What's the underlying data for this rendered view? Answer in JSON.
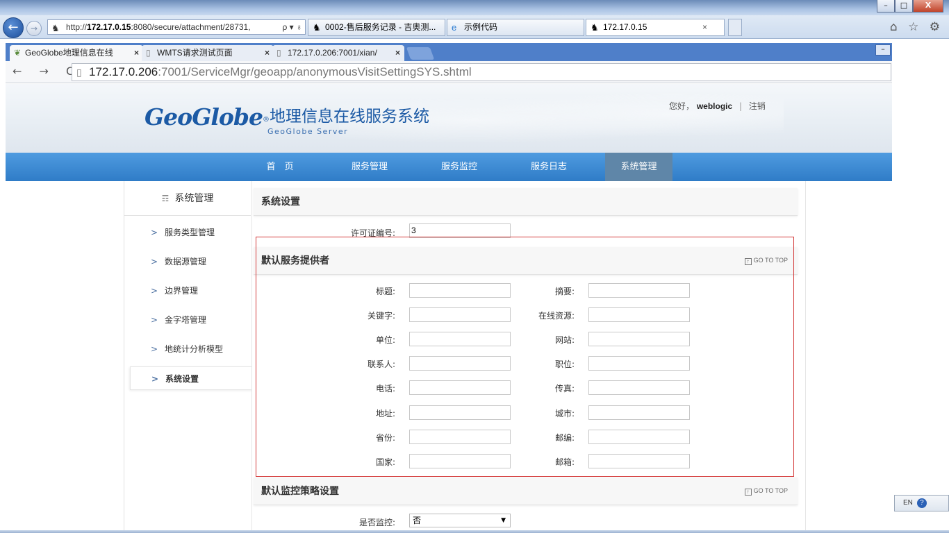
{
  "ie": {
    "address": {
      "prefix": "http://",
      "host": "172.17.0.15",
      "rest": ":8080/secure/attachment/28731,",
      "controls": "ρ ▾ ♁"
    },
    "tabs": [
      {
        "label": "0002-售后服务记录 - 吉奥测..."
      },
      {
        "label": "示例代码"
      },
      {
        "label": "172.17.0.15",
        "close": "×"
      }
    ],
    "right_icons": "⌂ ☆ ⚙",
    "window_buttons": [
      "–",
      "□",
      "X"
    ]
  },
  "chrome": {
    "tabs": [
      {
        "label": "GeoGlobe地理信息在线",
        "close": "×"
      },
      {
        "label": "WMTS请求测试页面",
        "close": "×"
      },
      {
        "label": "172.17.0.206:7001/xian/",
        "close": "×"
      }
    ],
    "url": {
      "host": "172.17.0.206",
      "rest": ":7001/ServiceMgr/geoapp/anonymousVisitSettingSYS.shtml"
    },
    "nav": "← → C"
  },
  "header": {
    "brand": "GeoGlobe",
    "reg": "®",
    "title_cn": "地理信息在线服务系统",
    "title_en": "GeoGlobe Server",
    "greeting": "您好，",
    "username": "weblogic",
    "separator": "|",
    "logout": "注销"
  },
  "nav": [
    {
      "label": "首　页"
    },
    {
      "label": "服务管理"
    },
    {
      "label": "服务监控"
    },
    {
      "label": "服务日志"
    },
    {
      "label": "系统管理",
      "active": true
    }
  ],
  "sidebar": {
    "title": "系统管理",
    "items": [
      {
        "label": "服务类型管理"
      },
      {
        "label": "数据源管理"
      },
      {
        "label": "边界管理"
      },
      {
        "label": "金字塔管理"
      },
      {
        "label": "地统计分析模型"
      },
      {
        "label": "系统设置",
        "active": true
      }
    ]
  },
  "content": {
    "system_settings": {
      "title": "系统设置",
      "license_label": "许可证编号:",
      "license_value": "3"
    },
    "provider": {
      "title": "默认服务提供者",
      "goto": "GO TO TOP",
      "fields_left": [
        {
          "label": "标题:",
          "value": ""
        },
        {
          "label": "关键字:",
          "value": ""
        },
        {
          "label": "单位:",
          "value": ""
        },
        {
          "label": "联系人:",
          "value": ""
        },
        {
          "label": "电话:",
          "value": ""
        },
        {
          "label": "地址:",
          "value": ""
        },
        {
          "label": "省份:",
          "value": ""
        },
        {
          "label": "国家:",
          "value": ""
        }
      ],
      "fields_right": [
        {
          "label": "摘要:",
          "value": ""
        },
        {
          "label": "在线资源:",
          "value": ""
        },
        {
          "label": "网站:",
          "value": ""
        },
        {
          "label": "职位:",
          "value": ""
        },
        {
          "label": "传真:",
          "value": ""
        },
        {
          "label": "城市:",
          "value": ""
        },
        {
          "label": "邮编:",
          "value": ""
        },
        {
          "label": "邮箱:",
          "value": ""
        }
      ]
    },
    "monitor": {
      "title": "默认监控策略设置",
      "goto": "GO TO TOP",
      "monitor_label": "是否监控:",
      "monitor_value": "否"
    }
  },
  "ime": {
    "lang": "EN",
    "help": "?"
  }
}
